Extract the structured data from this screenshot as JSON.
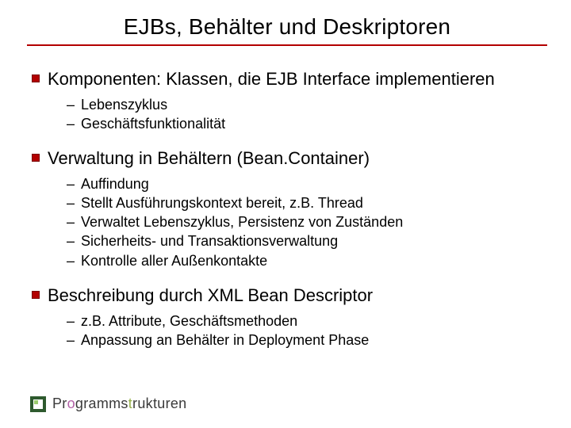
{
  "title": "EJBs, Behälter und Deskriptoren",
  "points": [
    {
      "text": "Komponenten: Klassen, die EJB Interface implementieren",
      "sub": [
        "Lebenszyklus",
        "Geschäftsfunktionalität"
      ]
    },
    {
      "text": "Verwaltung in Behältern (Bean.Container)",
      "sub": [
        "Auffindung",
        "Stellt Ausführungskontext bereit, z.B. Thread",
        "Verwaltet Lebenszyklus, Persistenz von Zuständen",
        "Sicherheits- und Transaktionsverwaltung",
        "Kontrolle aller Außenkontakte"
      ]
    },
    {
      "text": "Beschreibung durch XML Bean Descriptor",
      "sub": [
        "z.B. Attribute, Geschäftsmethoden",
        "Anpassung an Behälter in Deployment Phase"
      ]
    }
  ],
  "footer": {
    "brand_pre": "Pr",
    "brand_o": "o",
    "brand_mid": "gramms",
    "brand_t": "t",
    "brand_r": "r",
    "brand_post": "ukturen"
  }
}
